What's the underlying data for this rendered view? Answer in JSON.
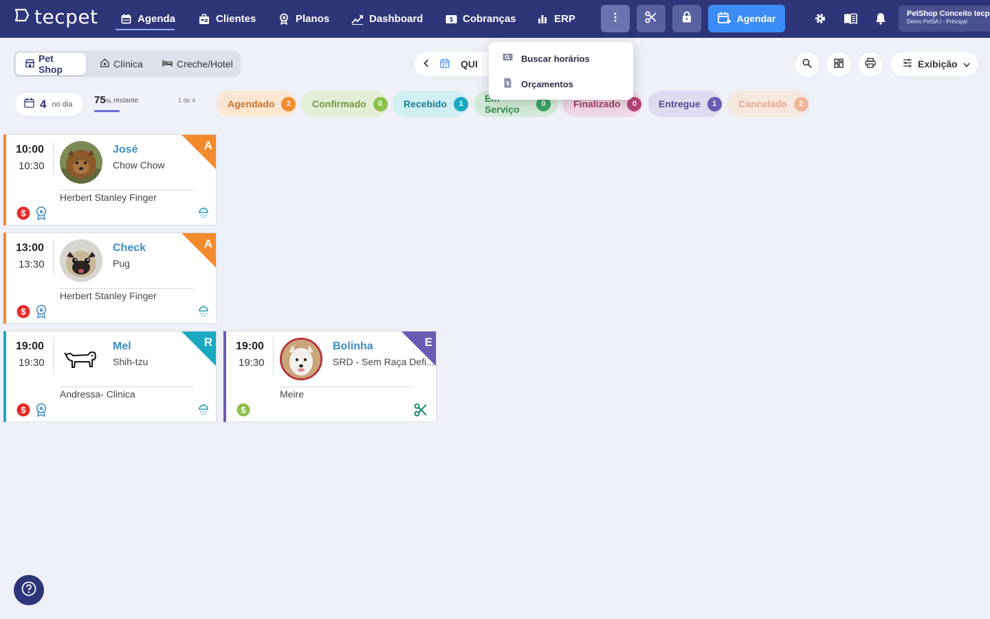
{
  "app": {
    "logo": "tecpet"
  },
  "nav": {
    "agenda": "Agenda",
    "clientes": "Clientes",
    "planos": "Planos",
    "dashboard": "Dashboard",
    "cobrancas": "Cobranças",
    "erp": "ERP"
  },
  "toolbar": {
    "agendar": "Agendar"
  },
  "account": {
    "name": "PetShop Conceito tecpet",
    "sub": "Demo PetSA I - Principal"
  },
  "segments": {
    "petshop": "Pet Shop",
    "clinica": "Clínica",
    "creche": "Creche/Hotel"
  },
  "date": {
    "label": "QUI"
  },
  "view_button": "Exibição",
  "dropdown": {
    "buscar": "Buscar horários",
    "orcamentos": "Orçamentos"
  },
  "stats": {
    "count": "4",
    "count_label": "no dia",
    "percent": "75",
    "percent_unit": "%",
    "percent_label": "restante",
    "page": "1 de 4"
  },
  "statuses": [
    {
      "label": "Agendado",
      "count": "2"
    },
    {
      "label": "Confirmado",
      "count": "0"
    },
    {
      "label": "Recebido",
      "count": "1"
    },
    {
      "label": "Em Serviço",
      "count": "0"
    },
    {
      "label": "Finalizado",
      "count": "0"
    },
    {
      "label": "Entregue",
      "count": "1"
    },
    {
      "label": "Cancelado",
      "count": "2"
    }
  ],
  "appointments": [
    {
      "start": "10:00",
      "end": "10:30",
      "pet": "José",
      "breed": "Chow Chow",
      "owner": "Herbert Stanley Finger",
      "status_letter": "A",
      "payment_icon": "dollar-red-icon",
      "service_icon": "bath-icon"
    },
    {
      "start": "13:00",
      "end": "13:30",
      "pet": "Check",
      "breed": "Pug",
      "owner": "Herbert Stanley Finger",
      "status_letter": "A",
      "payment_icon": "dollar-red-icon",
      "service_icon": "bath-icon"
    },
    {
      "start": "19:00",
      "end": "19:30",
      "pet": "Mel",
      "breed": "Shih-tzu",
      "owner": "Andressa- Clinica",
      "status_letter": "R",
      "payment_icon": "dollar-red-icon",
      "service_icon": "bath-icon"
    },
    {
      "start": "19:00",
      "end": "19:30",
      "pet": "Bolinha",
      "breed": "SRD - Sem Raça Defi...",
      "owner": "Meire",
      "status_letter": "E",
      "payment_icon": "dollar-green-icon",
      "service_icon": "scissors-icon"
    }
  ],
  "colors": {
    "topbar": "#2e3579",
    "agendado": "#f28b2e",
    "recebido": "#1ba9c2",
    "entregue": "#6a5bb5",
    "primary": "#3d8cf6"
  }
}
